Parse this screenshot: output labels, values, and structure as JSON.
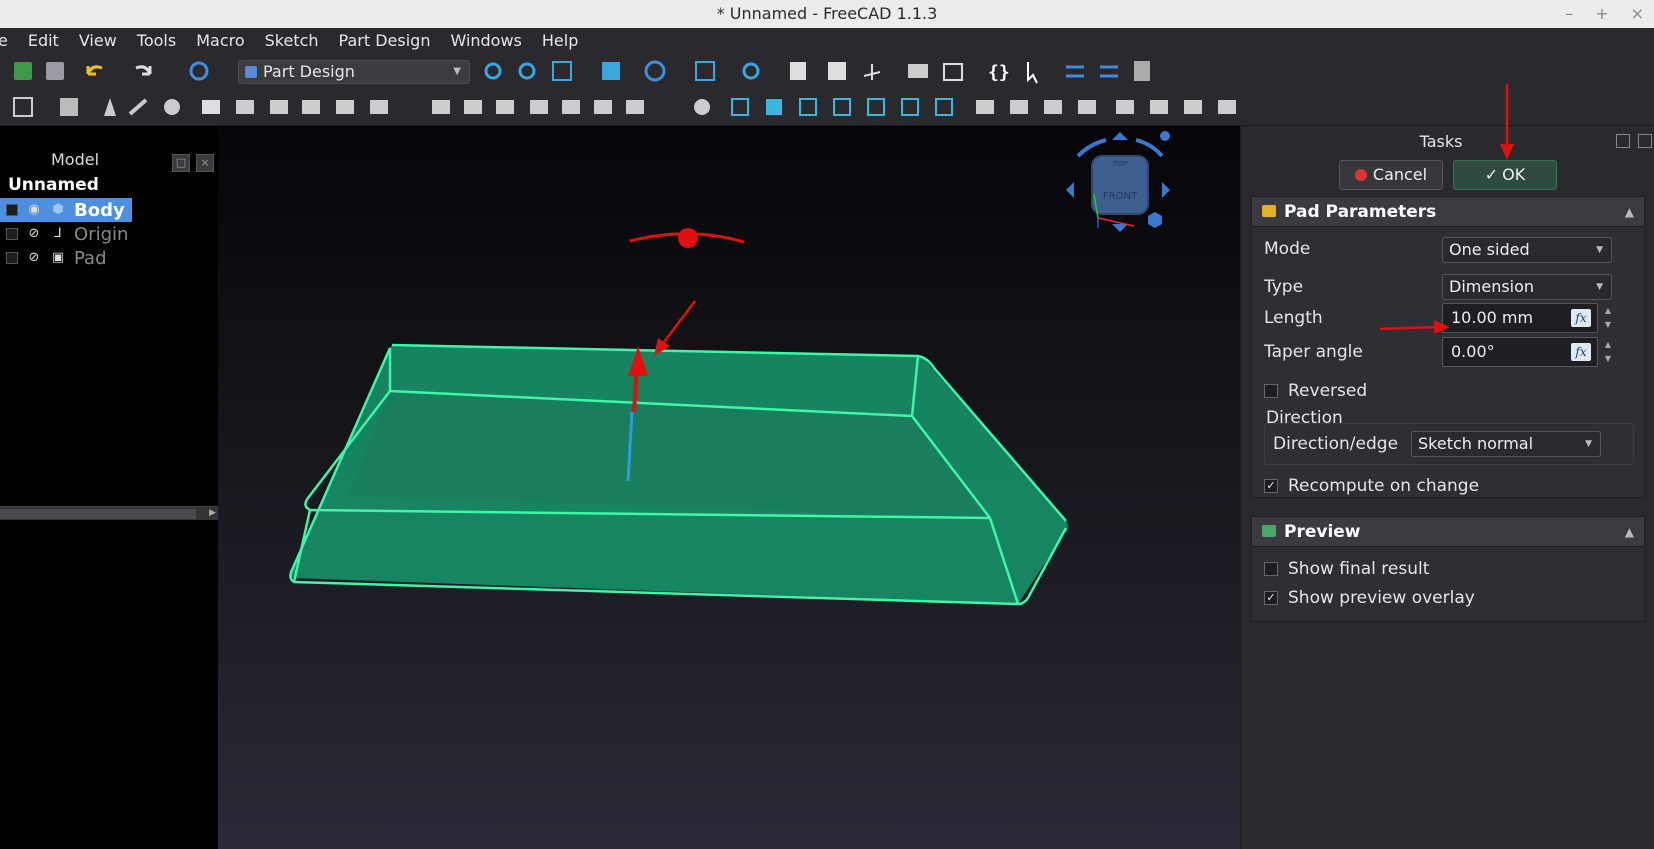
{
  "window": {
    "title": "* Unnamed - FreeCAD 1.1.3",
    "controls": [
      "–",
      "+",
      "×"
    ]
  },
  "menu": [
    "e",
    "Edit",
    "View",
    "Tools",
    "Macro",
    "Sketch",
    "Part Design",
    "Windows",
    "Help"
  ],
  "toolbar": {
    "workbench": "Part Design"
  },
  "model_panel": {
    "title": "Model",
    "root": "Unnamed",
    "items": [
      {
        "label": "Body",
        "selected": true
      },
      {
        "label": "Origin",
        "selected": false
      },
      {
        "label": "Pad",
        "selected": false
      }
    ]
  },
  "nav_cube": {
    "face": "FRONT",
    "top": "TOP"
  },
  "tasks": {
    "title": "Tasks",
    "cancel_label": "Cancel",
    "ok_label": "OK",
    "pad": {
      "header": "Pad Parameters",
      "mode_label": "Mode",
      "mode_value": "One sided",
      "type_label": "Type",
      "type_value": "Dimension",
      "length_label": "Length",
      "length_value": "10.00 mm",
      "taper_label": "Taper angle",
      "taper_value": "0.00°",
      "reversed_label": "Reversed",
      "reversed_checked": false,
      "direction_label": "Direction",
      "direction_edge_label": "Direction/edge",
      "direction_edge_value": "Sketch normal",
      "recompute_label": "Recompute on change",
      "recompute_checked": true,
      "fx_label": "fx"
    },
    "preview": {
      "header": "Preview",
      "show_final_label": "Show final result",
      "show_final_checked": false,
      "show_overlay_label": "Show preview overlay",
      "show_overlay_checked": true
    }
  },
  "colors": {
    "accent": "#4f8fe0",
    "annotation": "#e01010",
    "solid": "#1fbf7a",
    "edge": "#3ff5a8"
  }
}
